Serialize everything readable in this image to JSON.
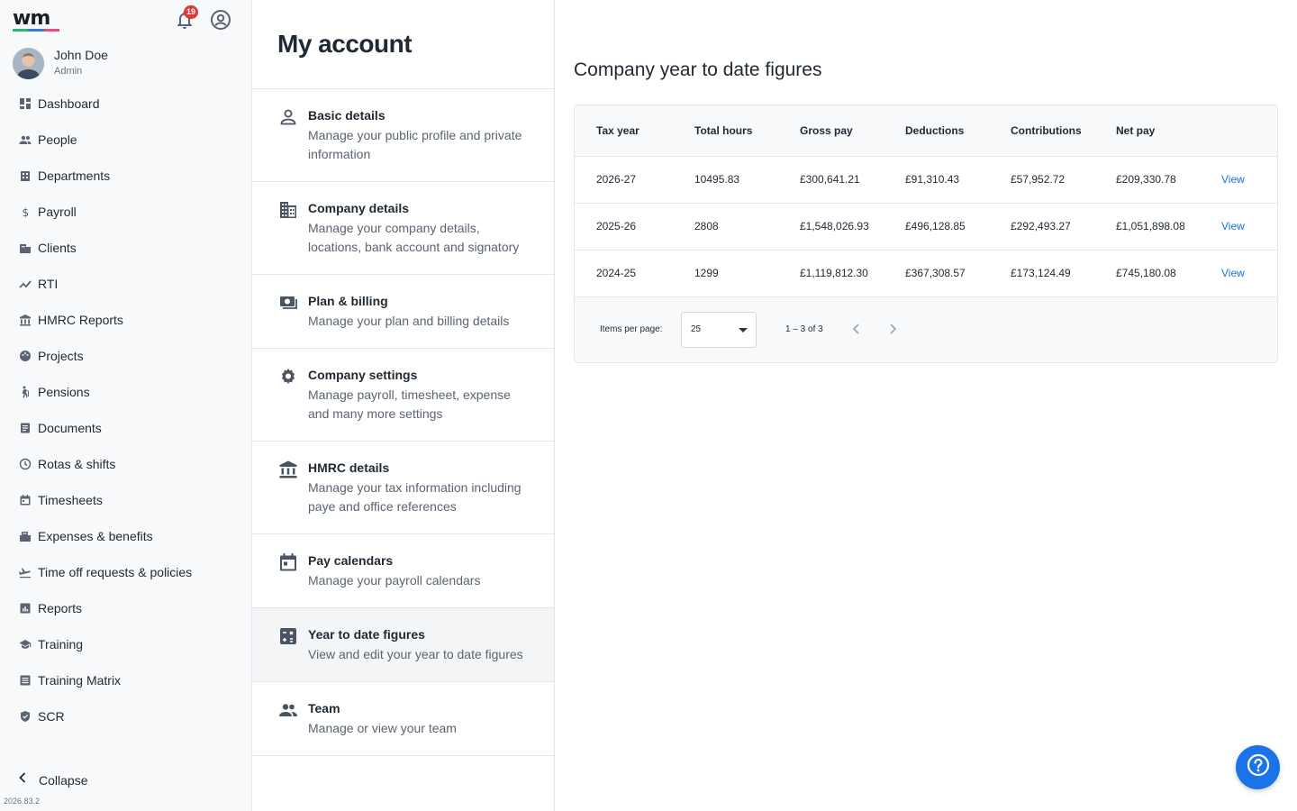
{
  "brand": {
    "logo_text": "wm",
    "logo_colors": [
      "#2bb673",
      "#3a7bd5",
      "#e94e77"
    ]
  },
  "header": {
    "notification_count": "19",
    "bell_icon": "bell-icon",
    "account_icon": "account-circle-icon"
  },
  "user": {
    "name": "John Doe",
    "role": "Admin"
  },
  "sidebar": {
    "items": [
      {
        "label": "Dashboard",
        "icon": "dashboard-icon"
      },
      {
        "label": "People",
        "icon": "people-icon"
      },
      {
        "label": "Departments",
        "icon": "building-icon"
      },
      {
        "label": "Payroll",
        "icon": "dollar-icon"
      },
      {
        "label": "Clients",
        "icon": "clients-icon"
      },
      {
        "label": "RTI",
        "icon": "trend-icon"
      },
      {
        "label": "HMRC Reports",
        "icon": "bank-icon"
      },
      {
        "label": "Projects",
        "icon": "palette-icon"
      },
      {
        "label": "Pensions",
        "icon": "elderly-icon"
      },
      {
        "label": "Documents",
        "icon": "document-icon"
      },
      {
        "label": "Rotas & shifts",
        "icon": "clock-icon"
      },
      {
        "label": "Timesheets",
        "icon": "calendar-icon"
      },
      {
        "label": "Expenses & benefits",
        "icon": "receipt-icon"
      },
      {
        "label": "Time off requests & policies",
        "icon": "plane-icon"
      },
      {
        "label": "Reports",
        "icon": "report-icon"
      },
      {
        "label": "Training",
        "icon": "school-icon"
      },
      {
        "label": "Training Matrix",
        "icon": "matrix-icon"
      },
      {
        "label": "SCR",
        "icon": "shield-icon"
      }
    ],
    "collapse_label": "Collapse",
    "version": "2026.83.2"
  },
  "account_menu": {
    "title": "My account",
    "items": [
      {
        "title": "Basic details",
        "desc": "Manage your public profile and private information",
        "icon": "person-icon"
      },
      {
        "title": "Company details",
        "desc": "Manage your company details, locations, bank account and signatory",
        "icon": "company-icon"
      },
      {
        "title": "Plan & billing",
        "desc": "Manage your plan and billing details",
        "icon": "money-icon"
      },
      {
        "title": "Company settings",
        "desc": "Manage payroll, timesheet, expense and many more settings",
        "icon": "gear-icon"
      },
      {
        "title": "HMRC details",
        "desc": "Manage your tax information including paye and office references",
        "icon": "bank-icon"
      },
      {
        "title": "Pay calendars",
        "desc": "Manage your payroll calendars",
        "icon": "calendar-icon"
      },
      {
        "title": "Year to date figures",
        "desc": "View and edit your year to date figures",
        "icon": "calculator-icon",
        "active": true
      },
      {
        "title": "Team",
        "desc": "Manage or view your team",
        "icon": "group-icon"
      }
    ]
  },
  "main": {
    "title": "Company year to date figures",
    "columns": [
      "Tax year",
      "Total hours",
      "Gross pay",
      "Deductions",
      "Contributions",
      "Net pay",
      ""
    ],
    "rows": [
      {
        "tax_year": "2026-27",
        "hours": "10495.83",
        "gross": "£300,641.21",
        "deductions": "£91,310.43",
        "contributions": "£57,952.72",
        "net": "£209,330.78",
        "action": "View"
      },
      {
        "tax_year": "2025-26",
        "hours": "2808",
        "gross": "£1,548,026.93",
        "deductions": "£496,128.85",
        "contributions": "£292,493.27",
        "net": "£1,051,898.08",
        "action": "View"
      },
      {
        "tax_year": "2024-25",
        "hours": "1299",
        "gross": "£1,119,812.30",
        "deductions": "£367,308.57",
        "contributions": "£173,124.49",
        "net": "£745,180.08",
        "action": "View"
      }
    ],
    "pager": {
      "label": "Items per page:",
      "per_page": "25",
      "range": "1 – 3 of 3"
    }
  },
  "help_icon": "help-icon"
}
